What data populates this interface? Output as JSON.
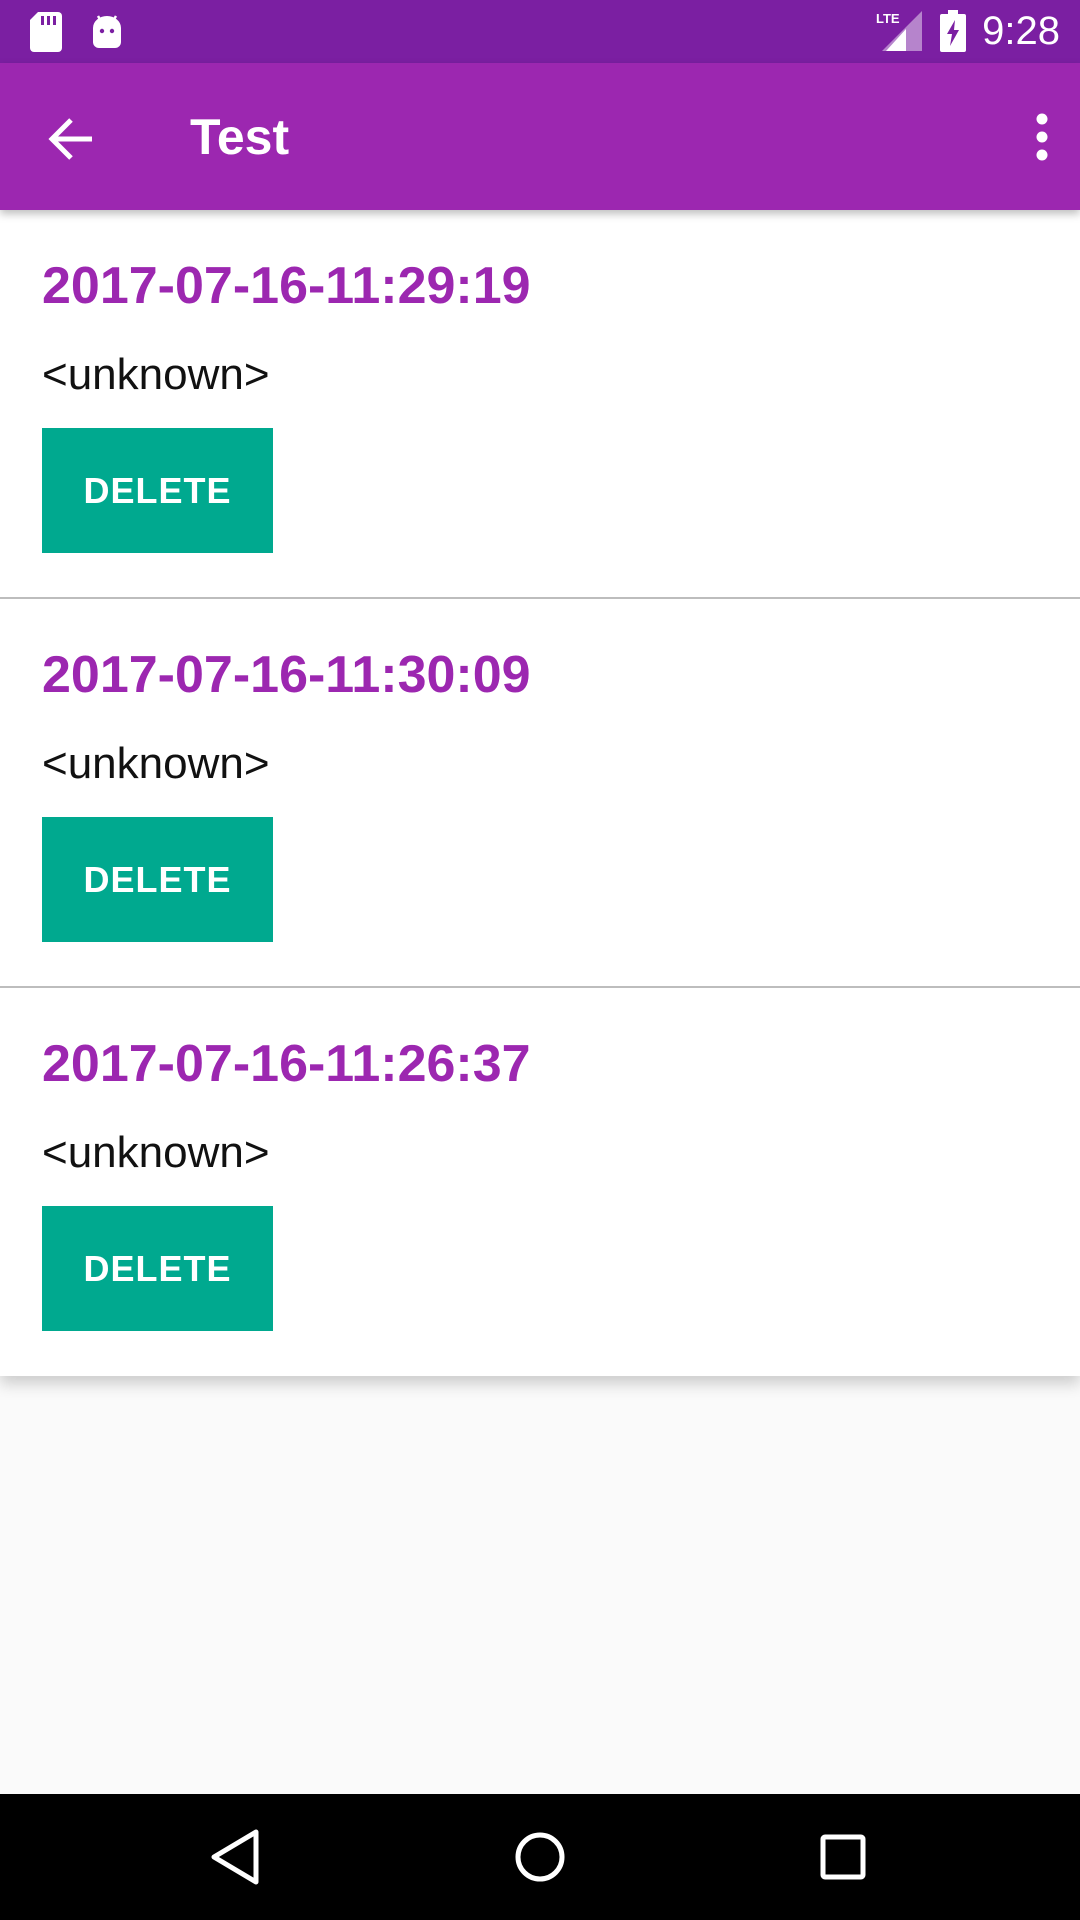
{
  "status_bar": {
    "left_icons": [
      "sd-card-icon",
      "android-debug-icon"
    ],
    "right_icons": [
      "lte-signal-icon",
      "battery-charging-icon"
    ],
    "network_label": "LTE",
    "time": "9:28"
  },
  "app_bar": {
    "title": "Test",
    "back_icon": "arrow-back-icon",
    "menu_icon": "more-vert-icon"
  },
  "items": [
    {
      "timestamp": "2017-07-16-11:29:19",
      "subtitle": "<unknown>",
      "delete_label": "DELETE"
    },
    {
      "timestamp": "2017-07-16-11:30:09",
      "subtitle": "<unknown>",
      "delete_label": "DELETE"
    },
    {
      "timestamp": "2017-07-16-11:26:37",
      "subtitle": "<unknown>",
      "delete_label": "DELETE"
    }
  ],
  "nav_bar": {
    "icons": [
      "back-triangle-icon",
      "home-circle-icon",
      "recents-square-icon"
    ]
  },
  "colors": {
    "status_bar": "#7b1fa2",
    "app_bar": "#9c27b0",
    "accent_title": "#9c27b0",
    "delete_button": "#00a98f"
  }
}
